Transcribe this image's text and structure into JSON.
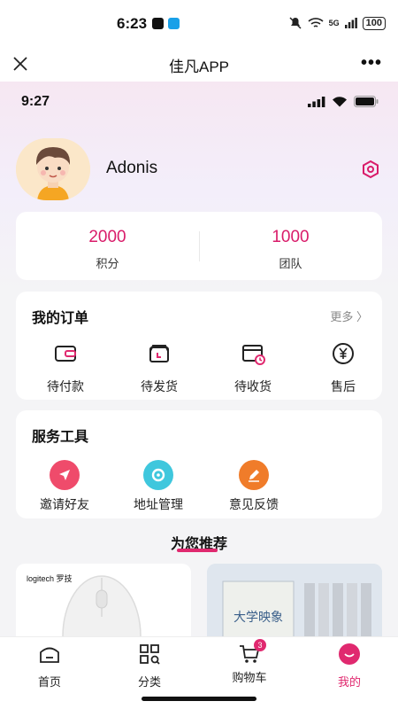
{
  "system": {
    "time": "6:23",
    "battery": "100",
    "net": "5G"
  },
  "nav": {
    "title": "佳凡APP",
    "more": "•••"
  },
  "inner_status": {
    "time": "9:27"
  },
  "profile": {
    "username": "Adonis"
  },
  "stats": [
    {
      "value": "2000",
      "label": "积分"
    },
    {
      "value": "1000",
      "label": "团队"
    }
  ],
  "orders": {
    "title": "我的订单",
    "more": "更多 〉",
    "items": [
      {
        "label": "待付款",
        "icon": "wallet-icon"
      },
      {
        "label": "待发货",
        "icon": "box-icon"
      },
      {
        "label": "待收货",
        "icon": "delivery-icon"
      },
      {
        "label": "售后",
        "icon": "yen-icon"
      }
    ]
  },
  "services": {
    "title": "服务工具",
    "items": [
      {
        "label": "邀请好友",
        "icon": "send-icon",
        "color": "#ef4b6b"
      },
      {
        "label": "地址管理",
        "icon": "location-icon",
        "color": "#3fc7dd"
      },
      {
        "label": "意见反馈",
        "icon": "pencil-icon",
        "color": "#f07c2a"
      }
    ]
  },
  "recommend": {
    "title": "为您推荐"
  },
  "products": [
    {
      "brand": "logitech 罗技"
    },
    {
      "brand": "大学映象"
    }
  ],
  "tabs": [
    {
      "label": "首页",
      "icon": "home-icon"
    },
    {
      "label": "分类",
      "icon": "category-icon"
    },
    {
      "label": "购物车",
      "icon": "cart-icon",
      "badge": "3"
    },
    {
      "label": "我的",
      "icon": "profile-icon",
      "active": true
    }
  ],
  "colors": {
    "accent": "#e0296f"
  }
}
